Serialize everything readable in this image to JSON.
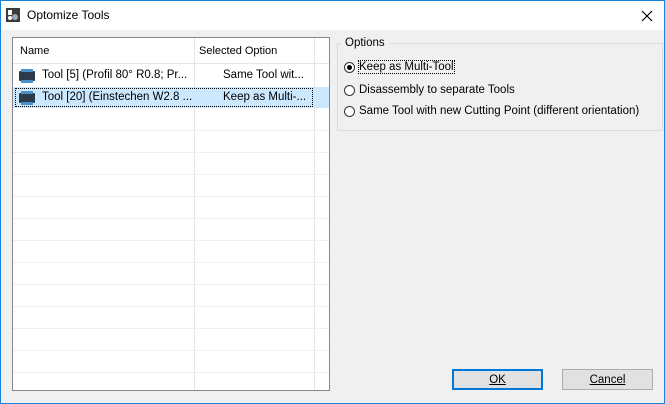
{
  "window": {
    "title": "Optomize Tools"
  },
  "list": {
    "columns": [
      "Name",
      "Selected Option"
    ],
    "rows": [
      {
        "name": "Tool [5] (Profil 80° R0.8; Pr...",
        "option": "Same Tool wit...",
        "selected": false
      },
      {
        "name": "Tool [20] (Einstechen W2.8 ...",
        "option": "Keep as Multi-...",
        "selected": true
      }
    ]
  },
  "options": {
    "label": "Options",
    "items": [
      {
        "label": "Keep as Multi-Tool",
        "checked": true
      },
      {
        "label": "Disassembly to separate Tools",
        "checked": false
      },
      {
        "label": "Same Tool with new Cutting Point (different orientation)",
        "checked": false
      }
    ]
  },
  "buttons": {
    "ok": "OK",
    "cancel": "Cancel"
  },
  "colors": {
    "selection": "#cce8ff",
    "accent": "#0078d7"
  }
}
